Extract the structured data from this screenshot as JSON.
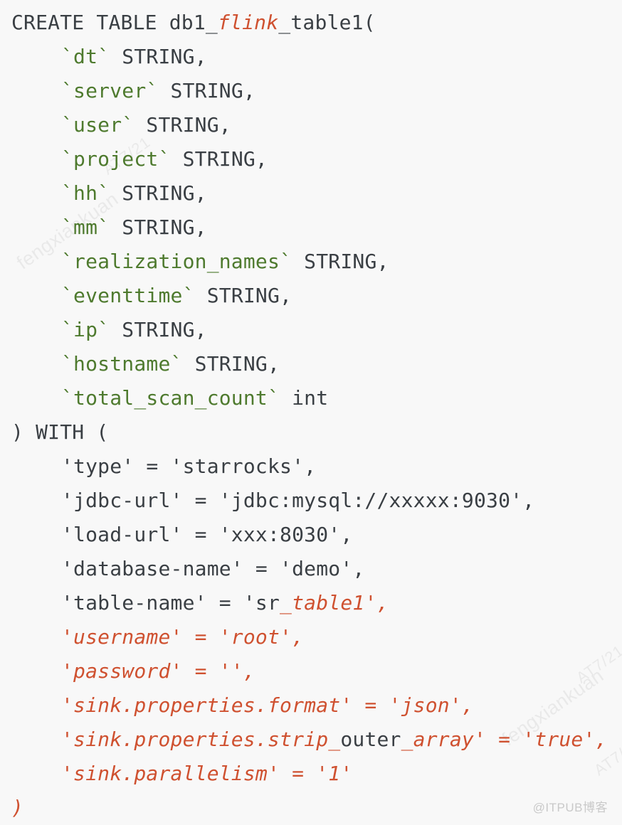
{
  "document": {
    "kind": "sql-code-snippet",
    "language": "Flink SQL",
    "background_color": "#f8f8f8",
    "colors": {
      "plain": "#3a3f44",
      "identifier": "#4e7a2e",
      "accent": "#cf5130",
      "watermark": "#8a8a8a",
      "footer": "#c9c9c9"
    }
  },
  "footer": {
    "mark": "@ITPUB博客"
  },
  "watermarks": {
    "primary": "fengxiankuan",
    "secondary": "AT7/21"
  },
  "code": {
    "lines": [
      {
        "indent": false,
        "spans": [
          {
            "text": "CREATE TABLE db1_",
            "style": "plain"
          },
          {
            "text": "flink",
            "style": "accent"
          },
          {
            "text": "_table1(",
            "style": "plain"
          }
        ]
      },
      {
        "indent": true,
        "spans": [
          {
            "text": "`dt`",
            "style": "ident"
          },
          {
            "text": " STRING,",
            "style": "plain"
          }
        ]
      },
      {
        "indent": true,
        "spans": [
          {
            "text": "`server`",
            "style": "ident"
          },
          {
            "text": " STRING,",
            "style": "plain"
          }
        ]
      },
      {
        "indent": true,
        "spans": [
          {
            "text": "`user`",
            "style": "ident"
          },
          {
            "text": " STRING,",
            "style": "plain"
          }
        ]
      },
      {
        "indent": true,
        "spans": [
          {
            "text": "`project`",
            "style": "ident"
          },
          {
            "text": " STRING,",
            "style": "plain"
          }
        ]
      },
      {
        "indent": true,
        "spans": [
          {
            "text": "`hh`",
            "style": "ident"
          },
          {
            "text": " STRING,",
            "style": "plain"
          }
        ]
      },
      {
        "indent": true,
        "spans": [
          {
            "text": "`mm`",
            "style": "ident"
          },
          {
            "text": " STRING,",
            "style": "plain"
          }
        ]
      },
      {
        "indent": true,
        "spans": [
          {
            "text": "`realization_names`",
            "style": "ident"
          },
          {
            "text": " STRING,",
            "style": "plain"
          }
        ]
      },
      {
        "indent": true,
        "spans": [
          {
            "text": "`eventtime`",
            "style": "ident"
          },
          {
            "text": " STRING,",
            "style": "plain"
          }
        ]
      },
      {
        "indent": true,
        "spans": [
          {
            "text": "`ip`",
            "style": "ident"
          },
          {
            "text": " STRING,",
            "style": "plain"
          }
        ]
      },
      {
        "indent": true,
        "spans": [
          {
            "text": "`hostname`",
            "style": "ident"
          },
          {
            "text": " STRING,",
            "style": "plain"
          }
        ]
      },
      {
        "indent": true,
        "spans": [
          {
            "text": "`total_scan_count`",
            "style": "ident"
          },
          {
            "text": " int",
            "style": "plain"
          }
        ]
      },
      {
        "indent": false,
        "spans": [
          {
            "text": ") WITH (",
            "style": "plain"
          }
        ]
      },
      {
        "indent": true,
        "spans": [
          {
            "text": "'type' = 'starrocks',",
            "style": "plain"
          }
        ]
      },
      {
        "indent": true,
        "spans": [
          {
            "text": "'jdbc-url' = 'jdbc:mysql://xxxxx:9030',",
            "style": "plain"
          }
        ]
      },
      {
        "indent": true,
        "spans": [
          {
            "text": "'load-url' = 'xxx:8030',",
            "style": "plain"
          }
        ]
      },
      {
        "indent": true,
        "spans": [
          {
            "text": "'database-name' = 'demo',",
            "style": "plain"
          }
        ]
      },
      {
        "indent": true,
        "spans": [
          {
            "text": "'table-name' = 'sr",
            "style": "plain"
          },
          {
            "text": "_table1',",
            "style": "accent"
          }
        ]
      },
      {
        "indent": true,
        "spans": [
          {
            "text": "'username' = 'root',",
            "style": "accent"
          }
        ]
      },
      {
        "indent": true,
        "spans": [
          {
            "text": "'password' = '',",
            "style": "accent"
          }
        ]
      },
      {
        "indent": true,
        "spans": [
          {
            "text": "'sink.properties.format' = 'json',",
            "style": "accent"
          }
        ]
      },
      {
        "indent": true,
        "spans": [
          {
            "text": "'sink.properties.strip_",
            "style": "accent"
          },
          {
            "text": "outer",
            "style": "plain"
          },
          {
            "text": "_array' = 'true',",
            "style": "accent"
          }
        ]
      },
      {
        "indent": true,
        "spans": [
          {
            "text": "'sink.parallelism' = '1'",
            "style": "accent"
          }
        ]
      },
      {
        "indent": false,
        "spans": [
          {
            "text": ")",
            "style": "accent"
          }
        ]
      }
    ]
  }
}
